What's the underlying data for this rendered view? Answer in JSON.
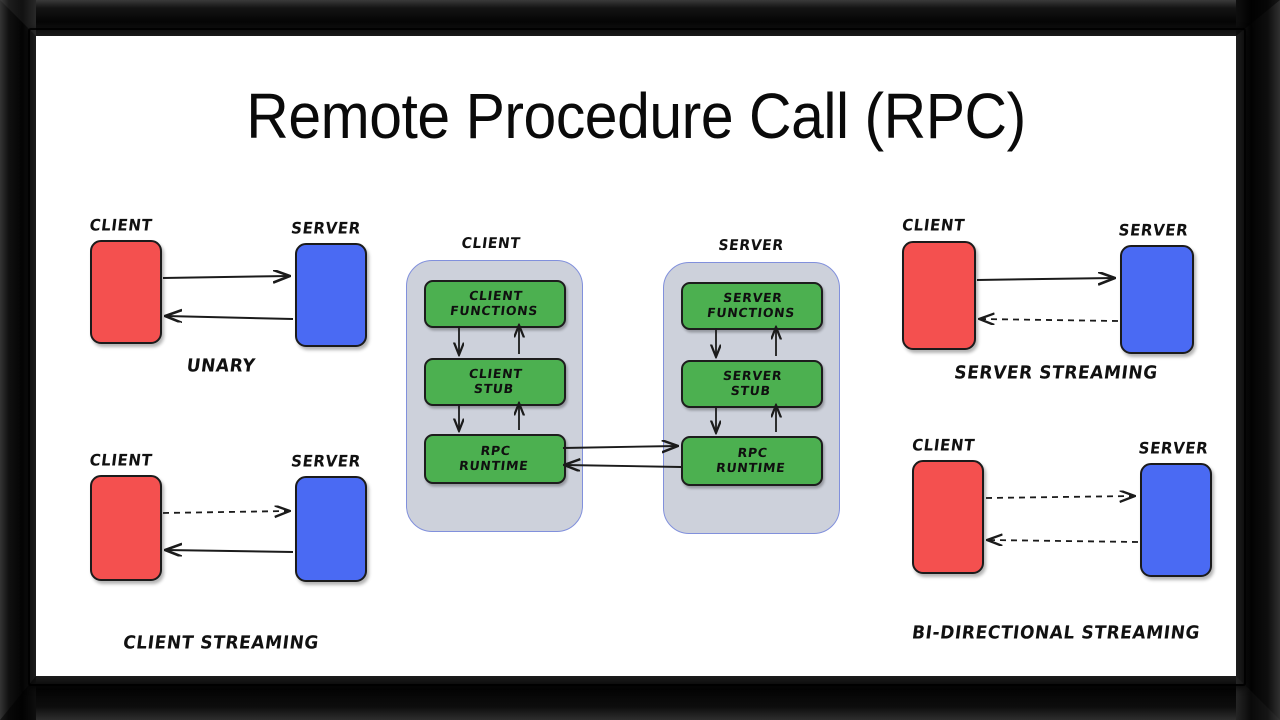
{
  "slide": {
    "title": "Remote Procedure Call (RPC)",
    "background": "#ffffff",
    "frame_color": "#0a0a0a"
  },
  "colors": {
    "client_box": "#F4504F",
    "server_box": "#4A6AF3",
    "stage_box": "#4CB050",
    "host_panel": "#CDD1DB",
    "host_border": "#8190DC",
    "stroke": "#1b1b1b"
  },
  "panels": [
    {
      "id": "unary",
      "caption": "UNARY",
      "client_label": "CLIENT",
      "server_label": "SERVER",
      "arrows": [
        {
          "direction": "right",
          "style": "solid"
        },
        {
          "direction": "left",
          "style": "solid"
        }
      ]
    },
    {
      "id": "client-streaming",
      "caption": "CLIENT STREAMING",
      "client_label": "CLIENT",
      "server_label": "SERVER",
      "arrows": [
        {
          "direction": "right",
          "style": "dashed"
        },
        {
          "direction": "left",
          "style": "solid"
        }
      ]
    },
    {
      "id": "server-streaming",
      "caption": "SERVER STREAMING",
      "client_label": "CLIENT",
      "server_label": "SERVER",
      "arrows": [
        {
          "direction": "right",
          "style": "solid"
        },
        {
          "direction": "left",
          "style": "dashed"
        }
      ]
    },
    {
      "id": "bi-directional-streaming",
      "caption": "BI-DIRECTIONAL STREAMING",
      "client_label": "CLIENT",
      "server_label": "SERVER",
      "arrows": [
        {
          "direction": "right",
          "style": "dashed"
        },
        {
          "direction": "left",
          "style": "dashed"
        }
      ]
    }
  ],
  "architecture": {
    "client_host": {
      "label": "CLIENT",
      "stages": [
        {
          "id": "client-functions",
          "text": "CLIENT\nFUNCTIONS"
        },
        {
          "id": "client-stub",
          "text": "CLIENT\nSTUB"
        },
        {
          "id": "client-runtime",
          "text": "RPC\nRUNTIME"
        }
      ]
    },
    "server_host": {
      "label": "SERVER",
      "stages": [
        {
          "id": "server-functions",
          "text": "SERVER\nFUNCTIONS"
        },
        {
          "id": "server-stub",
          "text": "SERVER\nSTUB"
        },
        {
          "id": "server-runtime",
          "text": "RPC\nRUNTIME"
        }
      ]
    },
    "network_arrows": [
      {
        "direction": "right",
        "style": "solid"
      },
      {
        "direction": "left",
        "style": "solid"
      }
    ]
  }
}
